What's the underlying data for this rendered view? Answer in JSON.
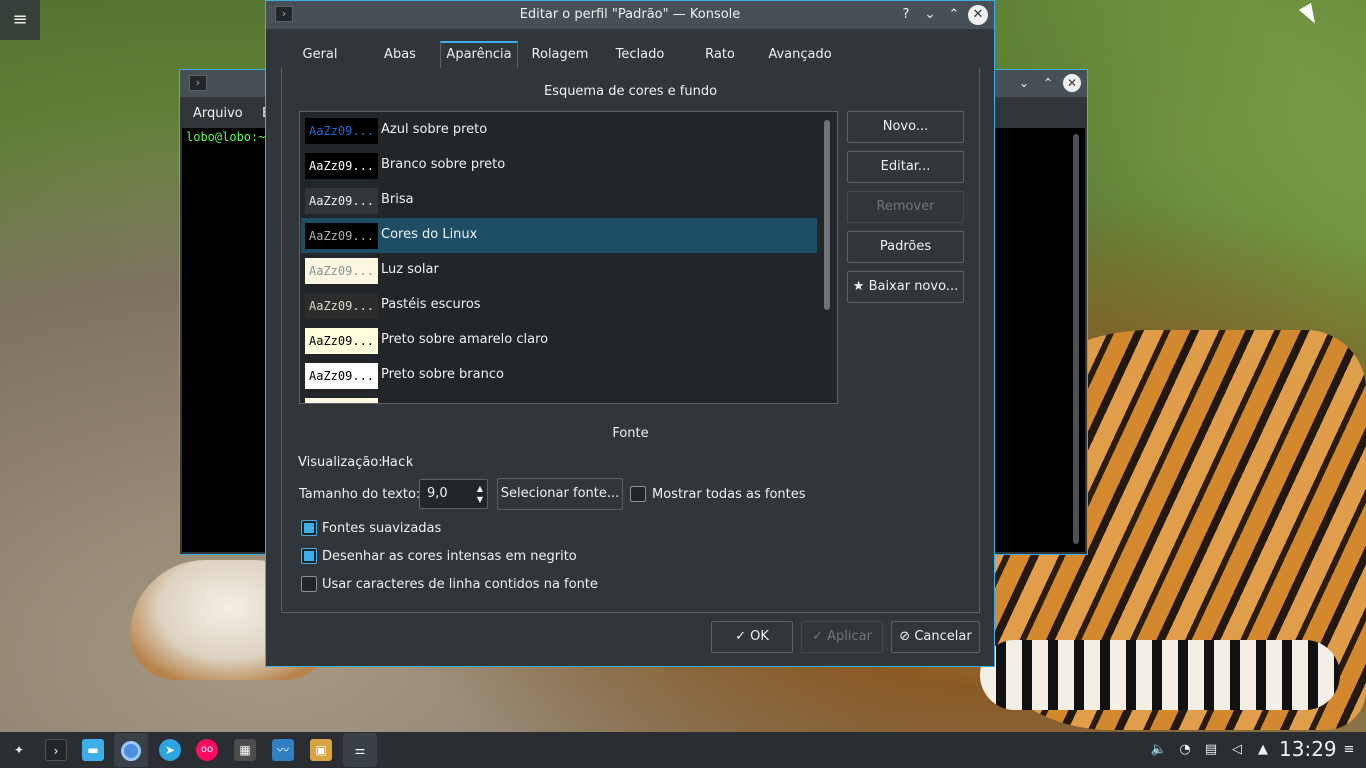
{
  "desktop": {
    "menu_icon": "hamburger-icon"
  },
  "background_window": {
    "menu_items": [
      "Arquivo",
      "E"
    ],
    "prompt": "lobo@lobo:~$"
  },
  "dialog": {
    "title": "Editar o perfil \"Padrão\" — Konsole",
    "controls": {
      "help": "?",
      "minimize": "⌄",
      "maximize": "⌃",
      "close": "✕"
    },
    "tabs": [
      {
        "label": "Geral"
      },
      {
        "label": "Abas"
      },
      {
        "label": "Aparência",
        "active": true
      },
      {
        "label": "Rolagem"
      },
      {
        "label": "Teclado"
      },
      {
        "label": "Rato"
      },
      {
        "label": "Avançado"
      }
    ],
    "color_section": {
      "title": "Esquema de cores e fundo",
      "schemes": [
        {
          "preview": "AaZz09...",
          "label": "Azul sobre preto",
          "bg": "#000000",
          "fg": "#1a6ae0"
        },
        {
          "preview": "AaZz09...",
          "label": "Branco sobre preto",
          "bg": "#000000",
          "fg": "#ffffff"
        },
        {
          "preview": "AaZz09...",
          "label": "Brisa",
          "bg": "#31363b",
          "fg": "#eff0f1"
        },
        {
          "preview": "AaZz09...",
          "label": "Cores do Linux",
          "bg": "#000000",
          "fg": "#b2b2b2",
          "selected": true
        },
        {
          "preview": "AaZz09...",
          "label": "Luz solar",
          "bg": "#fdf6e3",
          "fg": "#839496"
        },
        {
          "preview": "AaZz09...",
          "label": "Pastéis escuros",
          "bg": "#2c2c2c",
          "fg": "#dcdccc"
        },
        {
          "preview": "AaZz09...",
          "label": "Preto sobre amarelo claro",
          "bg": "#ffffdd",
          "fg": "#000000"
        },
        {
          "preview": "AaZz09...",
          "label": "Preto sobre branco",
          "bg": "#ffffff",
          "fg": "#000000"
        }
      ],
      "buttons": {
        "new": "Novo...",
        "edit": "Editar...",
        "remove": "Remover",
        "defaults": "Padrões",
        "download": "Baixar novo..."
      }
    },
    "font_section": {
      "title": "Fonte",
      "preview_label": "Visualização:",
      "preview_value": "Hack",
      "size_label": "Tamanho do texto:",
      "size_value": "9,0",
      "select_font": "Selecionar fonte...",
      "show_all_fonts": "Mostrar todas as fontes",
      "show_all_fonts_checked": false,
      "antialias": "Fontes suavizadas",
      "antialias_checked": true,
      "bold_intense": "Desenhar as cores intensas em negrito",
      "bold_intense_checked": true,
      "line_chars": "Usar caracteres de linha contidos na fonte",
      "line_chars_checked": false
    },
    "footer": {
      "ok": "OK",
      "apply": "Aplicar",
      "cancel": "Cancelar"
    }
  },
  "taskbar": {
    "clock": "13:29",
    "launchers": [
      "launcher-icon",
      "konsole-icon",
      "files-icon",
      "chromium-icon",
      "telegram-icon",
      "flickr-icon",
      "calculator-icon",
      "monitor-icon",
      "image-viewer-icon",
      "settings-icon"
    ],
    "tray": [
      "volume-icon",
      "wifi-icon",
      "clipboard-icon",
      "speaker-icon",
      "tray-expand-icon",
      "menu-icon"
    ]
  },
  "colors": {
    "accent": "#3daee9",
    "window_bg": "#31363b",
    "selection": "#1d4e66"
  }
}
